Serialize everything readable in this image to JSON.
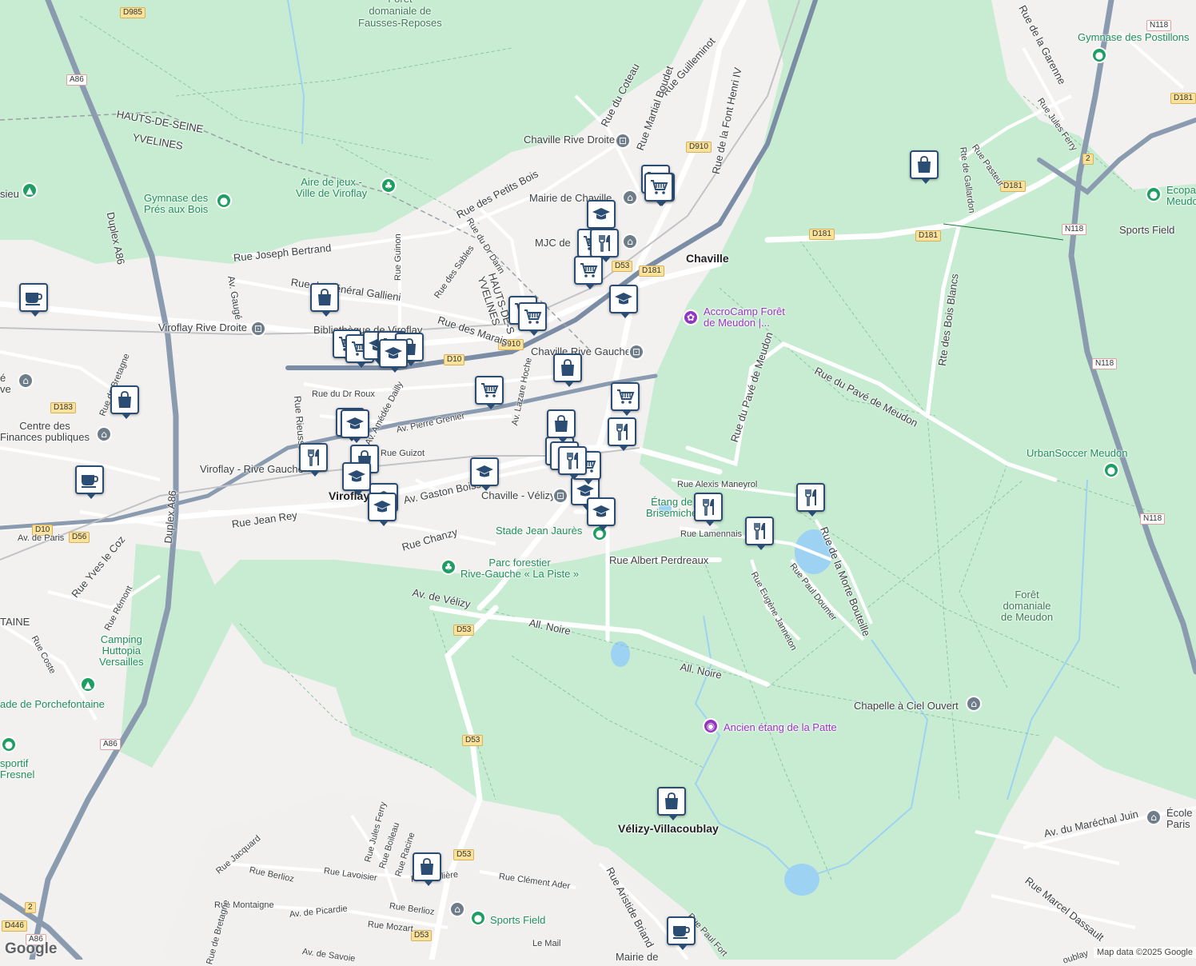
{
  "attribution": "Map data ©2025 Google",
  "logo": "Google",
  "labels": {
    "foret_fausses": "Forêt\ndomaniale de\nFausses-Reposes",
    "hauts_de_seine": "HAUTS-DE-SEINE",
    "yvelines": "YVELINES",
    "rue_du_coteau": "Rue du Coteau",
    "rue_guilleminot": "Rue Guilleminot",
    "rue_martial_boudet": "Rue Martial Boudet",
    "rue_font_henri": "Rue de la Font Henri IV",
    "chaville_rive_droite": "Chaville Rive Droite",
    "rue_petits_bois": "Rue des Petits Bois",
    "aire_de_jeux": "Aire de jeux -\nVille de Viroflay",
    "mairie_chaville": "Mairie de Chaville",
    "mjc": "MJC de",
    "gymnase_pres": "Gymnase des\nPrés aux Bois",
    "rue_joseph_bertrand": "Rue Joseph Bertrand",
    "rue_dr_darin": "Rue du Dr Darin",
    "rue_sables": "Rue des Sables",
    "rue_guinon": "Rue Guinon",
    "hauts_yvelines": "HAUTS-DE-S\nYVELINES",
    "rue_general_gallieni": "Rue du Général Gallieni",
    "av_gauge": "Av. Gaugé",
    "viroflay_rive_droite": "Viroflay Rive Droite",
    "bibliotheque": "Bibliothèque de Viroflay",
    "rue_des_marais": "Rue des Marais",
    "chaville": "Chaville",
    "chaville_rive_gauche": "Chaville Rive Gauche",
    "rue_dr_roux": "Rue du Dr Roux",
    "av_amedee_dailly": "Av. Amédée Dailly",
    "av_pierre_grenier": "Av. Pierre Grenier",
    "av_lazare_hoche": "Av. Lazare Hoche",
    "rue_rieussec": "Rue Rieussec",
    "centre_finances": "Centre des\nFinances publiques",
    "rue_guizot": "Rue Guizot",
    "viroflay_rive_gauche": "Viroflay - Rive Gauche",
    "viroflay": "Viroflay",
    "av_gaston_boissier": "Av. Gaston Boissier",
    "chaville_velizy": "Chaville - Vélizy",
    "rue_jean_rey": "Rue Jean Rey",
    "rue_chanzy": "Rue Chanzy",
    "stade_jean_jaures": "Stade Jean Jaurès",
    "etang_brisemiche": "Étang de\nBrisemiche",
    "rue_alexis_maneyrol": "Rue Alexis Maneyrol",
    "rue_lamennais": "Rue Lamennais",
    "rue_albert_perdreaux": "Rue Albert Perdreaux",
    "parc_forestier": "Parc forestier\nRive-Gauche « La Piste »",
    "av_de_velizy": "Av. de Vélizy",
    "all_noire_1": "All. Noire",
    "all_noire_2": "All. Noire",
    "rue_eugene_janneton": "Rue Eugène Janneton",
    "rue_paul_doumer": "Rue Paul Doumer",
    "rue_morte_bouteille": "Rue de la Morte Bouteille",
    "rue_pave_meudon": "Rue du Pavé de Meudon",
    "rue_pave_meudon_2": "Rue du Pavé de Meudon",
    "accrocamp": "AccroCamp Forêt\nde Meudon |...",
    "rte_bois_blancs": "Rte des Bois Blancs",
    "urbansoccer": "UrbanSoccer Meudon",
    "foret_meudon": "Forêt\ndomaniale\nde Meudon",
    "chapelle": "Chapelle à Ciel Ouvert",
    "ancien_etang": "Ancien étang de la Patte",
    "velizy": "Vélizy-Villacoublay",
    "gymnase_postillons": "Gymnase des Postillons",
    "rue_garenne": "Rue de la Garenne",
    "rue_jules_ferry_ne": "Rue Jules Ferry",
    "rue_pasteur": "Rue Pasteur",
    "rte_gallardon": "Rte de Gallardon",
    "ecopa": "Ecopa\nMeudo",
    "sports_field_ne": "Sports Field",
    "duplex_a86": "Duplex A86",
    "duplex_a86_2": "Duplex A86",
    "av_de_paris": "Av. de Paris",
    "rue_yves_le_coz": "Rue Yves le Coz",
    "rue_remont": "Rue Rémont",
    "rue_coste": "Rue Coste",
    "camping": "Camping\nHuttopia\nVersailles",
    "stade_porchefontaine": "ade de Porchefontaine",
    "sportif_fresnel": "sportif\nFresnel",
    "taine": "TAINE",
    "rue_jules_ferry_s": "Rue Jules Ferry",
    "rue_boileau": "Rue Boileau",
    "rue_racine": "Rue Racine",
    "rue_jacquard": "Rue Jacquard",
    "rue_berlioz": "Rue Berlioz",
    "rue_lavoisier": "Rue Lavoisier",
    "rue_moliere": "Rue Molière",
    "rue_berlioz_2": "Rue Berlioz",
    "rue_montaigne": "Rue Montaigne",
    "av_picardie": "Av. de Picardie",
    "rue_mozart": "Rue Mozart",
    "rue_clement_ader": "Rue Clément Ader",
    "sports_field_s": "Sports Field",
    "rue_aristide_briand": "Rue Aristide Briand",
    "rue_paul_fort": "Rue Paul Fort",
    "le_mail": "Le Mail",
    "mairie_s": "Mairie de",
    "av_savoie": "Av. de Savoie",
    "rue_bretagne": "Rue de Bretagne",
    "av_marechal_juin": "Av. du Maréchal Juin",
    "ecole_paris": "École\nParis",
    "rue_marcel_dassault": "Rue Marcel Dassault",
    "boublay": "oublay",
    "ve": "é\nve",
    "sieu": "sieu",
    "rue_bretagne_n": "Rue de Bretagne"
  },
  "shields": [
    "D985",
    "A86",
    "D910",
    "D181",
    "D181",
    "D181",
    "D181",
    "D53",
    "D181",
    "D910",
    "D10",
    "D183",
    "D10",
    "D56",
    "D53",
    "D53",
    "D53",
    "D53",
    "A86",
    "A86",
    "N118",
    "N118",
    "N118",
    "N118",
    "D446",
    "2",
    "2"
  ],
  "markers": [
    {
      "type": "cart-icon"
    },
    {
      "type": "cart-icon"
    },
    {
      "type": "school-icon"
    },
    {
      "type": "cart-icon"
    },
    {
      "type": "restaurant-icon"
    },
    {
      "type": "cart-icon"
    },
    {
      "type": "school-icon"
    },
    {
      "type": "cart-icon"
    },
    {
      "type": "cart-icon"
    },
    {
      "type": "bag-icon"
    },
    {
      "type": "cart-icon"
    },
    {
      "type": "cart-icon"
    },
    {
      "type": "school-icon"
    },
    {
      "type": "cart-icon"
    },
    {
      "type": "bag-icon"
    },
    {
      "type": "school-icon"
    },
    {
      "type": "bag-icon"
    },
    {
      "type": "cart-icon"
    },
    {
      "type": "restaurant-icon"
    },
    {
      "type": "cart-icon"
    },
    {
      "type": "school-icon"
    },
    {
      "type": "school-icon"
    },
    {
      "type": "restaurant-icon"
    },
    {
      "type": "restaurant-icon"
    },
    {
      "type": "restaurant-icon"
    },
    {
      "type": "restaurant-icon"
    },
    {
      "type": "bag-icon"
    },
    {
      "type": "school-icon"
    },
    {
      "type": "school-icon"
    },
    {
      "type": "school-icon"
    },
    {
      "type": "school-icon"
    },
    {
      "type": "cafe-icon"
    },
    {
      "type": "bag-icon"
    },
    {
      "type": "bag-icon"
    },
    {
      "type": "cafe-icon"
    },
    {
      "type": "bag-icon"
    },
    {
      "type": "bag-icon"
    },
    {
      "type": "cafe-icon"
    }
  ]
}
